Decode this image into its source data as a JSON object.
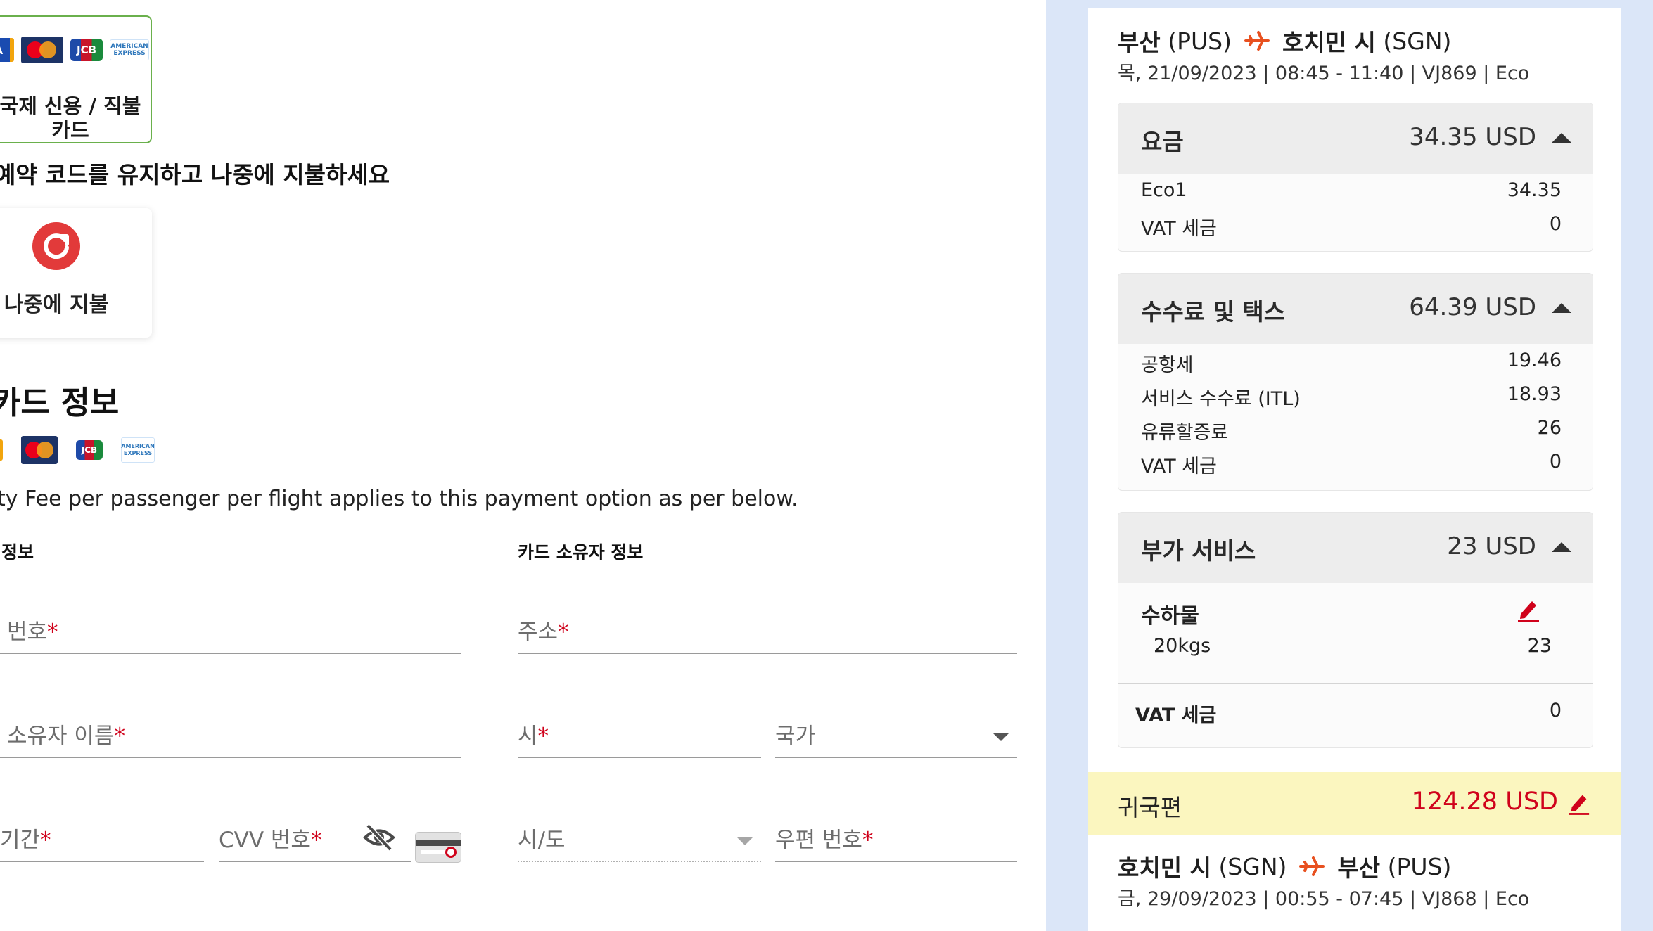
{
  "payment": {
    "card_option_label": "국제 신용 / 직불 카드",
    "hold_heading": "예약 코드를 유지하고 나중에 지불하세요",
    "pay_later_label": "나중에 지불",
    "card_info_heading": "카드 정보",
    "fee_note": "ty Fee per passenger per flight applies to this payment option as per below.",
    "card_section_label": "정보",
    "holder_section_label": "카드 소유자 정보",
    "fields": {
      "card_number": "번호",
      "cardholder_name": "소유자 이름",
      "expiry": "기간",
      "cvv": "CVV 번호",
      "address": "주소",
      "city": "시",
      "country": "국가",
      "state": "시/도",
      "postal": "우편 번호"
    },
    "required_mark": "*",
    "logos": {
      "visa": "VISA",
      "mastercard": "MasterCard",
      "jcb": "JCB",
      "amex": "AMERICAN EXPRESS"
    }
  },
  "summary": {
    "outbound": {
      "from": "부산",
      "from_code": "(PUS)",
      "to": "호치민 시",
      "to_code": "(SGN)",
      "details": "목, 21/09/2023 | 08:45 - 11:40 | VJ869 | Eco"
    },
    "fare": {
      "title": "요금",
      "amount": "34.35 USD",
      "items": [
        {
          "label": "Eco1",
          "value": "34.35"
        },
        {
          "label": "VAT 세금",
          "value": "0"
        }
      ]
    },
    "fees": {
      "title": "수수료 및 택스",
      "amount": "64.39 USD",
      "items": [
        {
          "label": "공항세",
          "value": "19.46"
        },
        {
          "label": "서비스 수수료 (ITL)",
          "value": "18.93"
        },
        {
          "label": "유류할증료",
          "value": "26"
        },
        {
          "label": "VAT 세금",
          "value": "0"
        }
      ]
    },
    "addons": {
      "title": "부가 서비스",
      "amount": "23 USD",
      "service_name": "수하물",
      "service_detail": "20kgs",
      "service_price": "23",
      "vat_label": "VAT 세금",
      "vat_value": "0"
    },
    "return": {
      "label": "귀국편",
      "amount": "124.28 USD",
      "from": "호치민 시",
      "from_code": "(SGN)",
      "to": "부산",
      "to_code": "(PUS)",
      "details": "금, 29/09/2023 | 00:55 - 07:45 | VJ868 | Eco"
    }
  },
  "colors": {
    "accent_red": "#d0021b",
    "selected_green": "#6ab04c",
    "panel_blue": "#dbe6f8",
    "return_yellow": "#fbf6bf"
  }
}
